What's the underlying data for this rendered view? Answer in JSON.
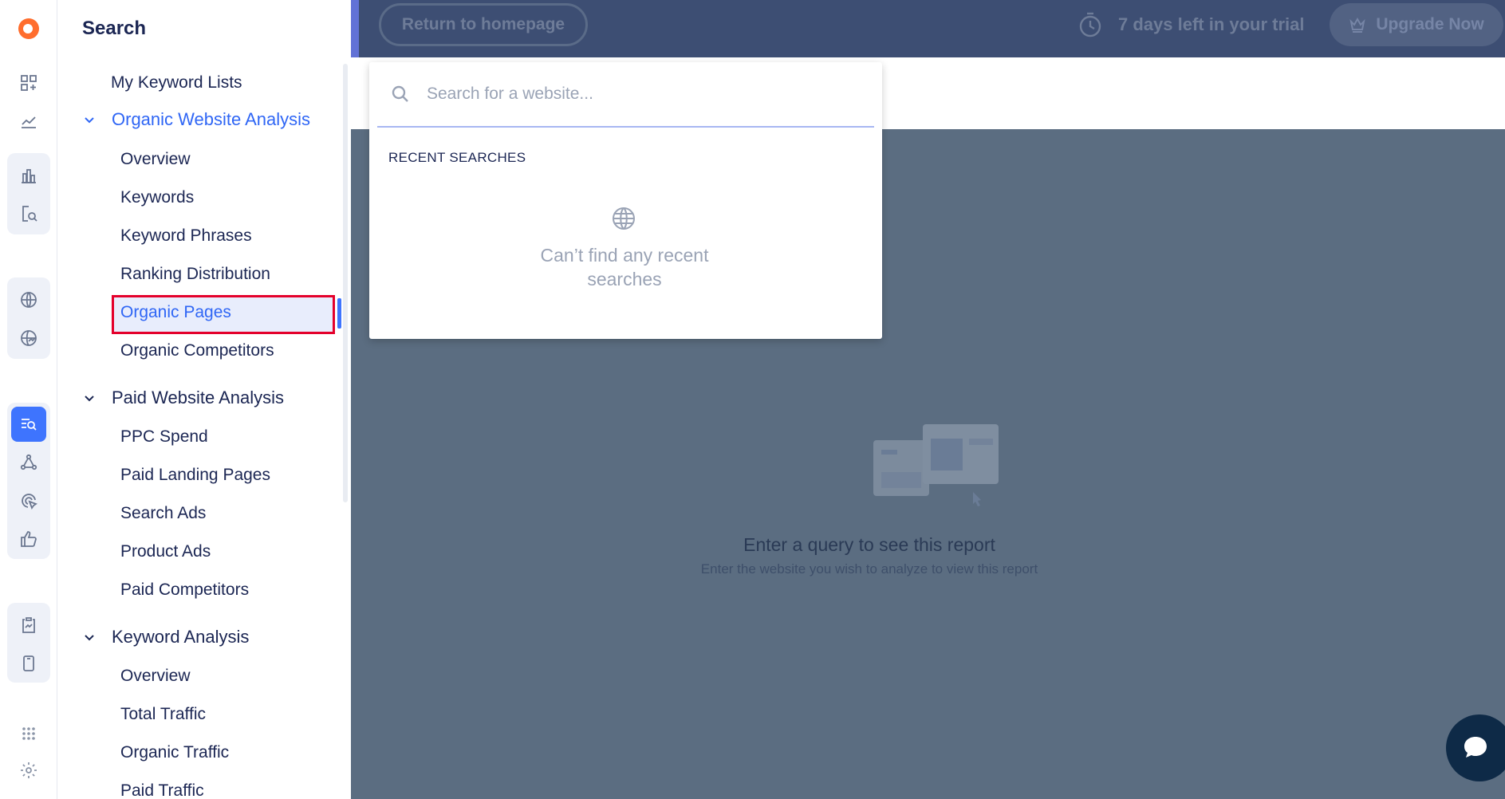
{
  "nav": {
    "title": "Search",
    "top_items": [
      {
        "label": "My Keyword Lists"
      }
    ],
    "sections": [
      {
        "label": "Organic Website Analysis",
        "items": [
          {
            "label": "Overview"
          },
          {
            "label": "Keywords"
          },
          {
            "label": "Keyword Phrases"
          },
          {
            "label": "Ranking Distribution"
          },
          {
            "label": "Organic Pages"
          },
          {
            "label": "Organic Competitors"
          }
        ]
      },
      {
        "label": "Paid Website Analysis",
        "items": [
          {
            "label": "PPC Spend"
          },
          {
            "label": "Paid Landing Pages"
          },
          {
            "label": "Search Ads"
          },
          {
            "label": "Product Ads"
          },
          {
            "label": "Paid Competitors"
          }
        ]
      },
      {
        "label": "Keyword Analysis",
        "items": [
          {
            "label": "Overview"
          },
          {
            "label": "Total Traffic"
          },
          {
            "label": "Organic Traffic"
          },
          {
            "label": "Paid Traffic"
          }
        ]
      }
    ]
  },
  "topbar": {
    "return_label": "Return to homepage",
    "trial_text": "7 days left in your trial",
    "upgrade_label": "Upgrade Now"
  },
  "search": {
    "placeholder": "Search for a website...",
    "recent_heading": "RECENT SEARCHES",
    "empty_text": "Can’t find any recent searches"
  },
  "report": {
    "empty_title": "Enter a query to see this report",
    "empty_subtitle": "Enter the website you wish to analyze to view this report"
  },
  "colors": {
    "accent": "#3e74fe",
    "overlay": "#5b6d81",
    "highlight_border": "#e4002b",
    "chat": "#0e2a47"
  }
}
